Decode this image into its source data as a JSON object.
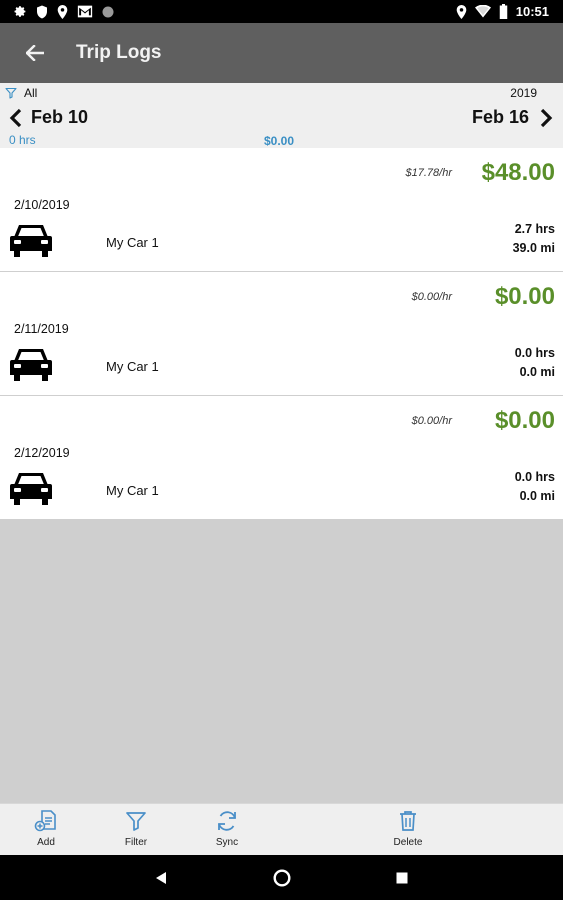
{
  "status_bar": {
    "time": "10:51",
    "left_icons": [
      "gear-icon",
      "shield-icon",
      "location-icon",
      "gmail-icon",
      "dot-icon"
    ],
    "right_icons": [
      "location-icon",
      "wifi-icon",
      "battery-icon"
    ]
  },
  "app_bar": {
    "title": "Trip Logs",
    "back_icon": "arrow-left-icon"
  },
  "week_header": {
    "filter_label": "All",
    "year": "2019",
    "start_date": "Feb 10",
    "end_date": "Feb 16",
    "total_hours": "0 hrs",
    "total_amount": "$0.00"
  },
  "trips": [
    {
      "date": "2/10/2019",
      "vehicle": "My Car 1",
      "rate": "$17.78/hr",
      "amount": "$48.00",
      "hours": "2.7 hrs",
      "miles": "39.0 mi"
    },
    {
      "date": "2/11/2019",
      "vehicle": "My Car 1",
      "rate": "$0.00/hr",
      "amount": "$0.00",
      "hours": "0.0 hrs",
      "miles": "0.0 mi"
    },
    {
      "date": "2/12/2019",
      "vehicle": "My Car 1",
      "rate": "$0.00/hr",
      "amount": "$0.00",
      "hours": "0.0 hrs",
      "miles": "0.0 mi"
    }
  ],
  "toolbar": {
    "add_label": "Add",
    "filter_label": "Filter",
    "sync_label": "Sync",
    "delete_label": "Delete"
  },
  "colors": {
    "app_bar": "#5f5f5f",
    "amount_green": "#5a8f2a",
    "accent_blue": "#3a8fc4"
  }
}
